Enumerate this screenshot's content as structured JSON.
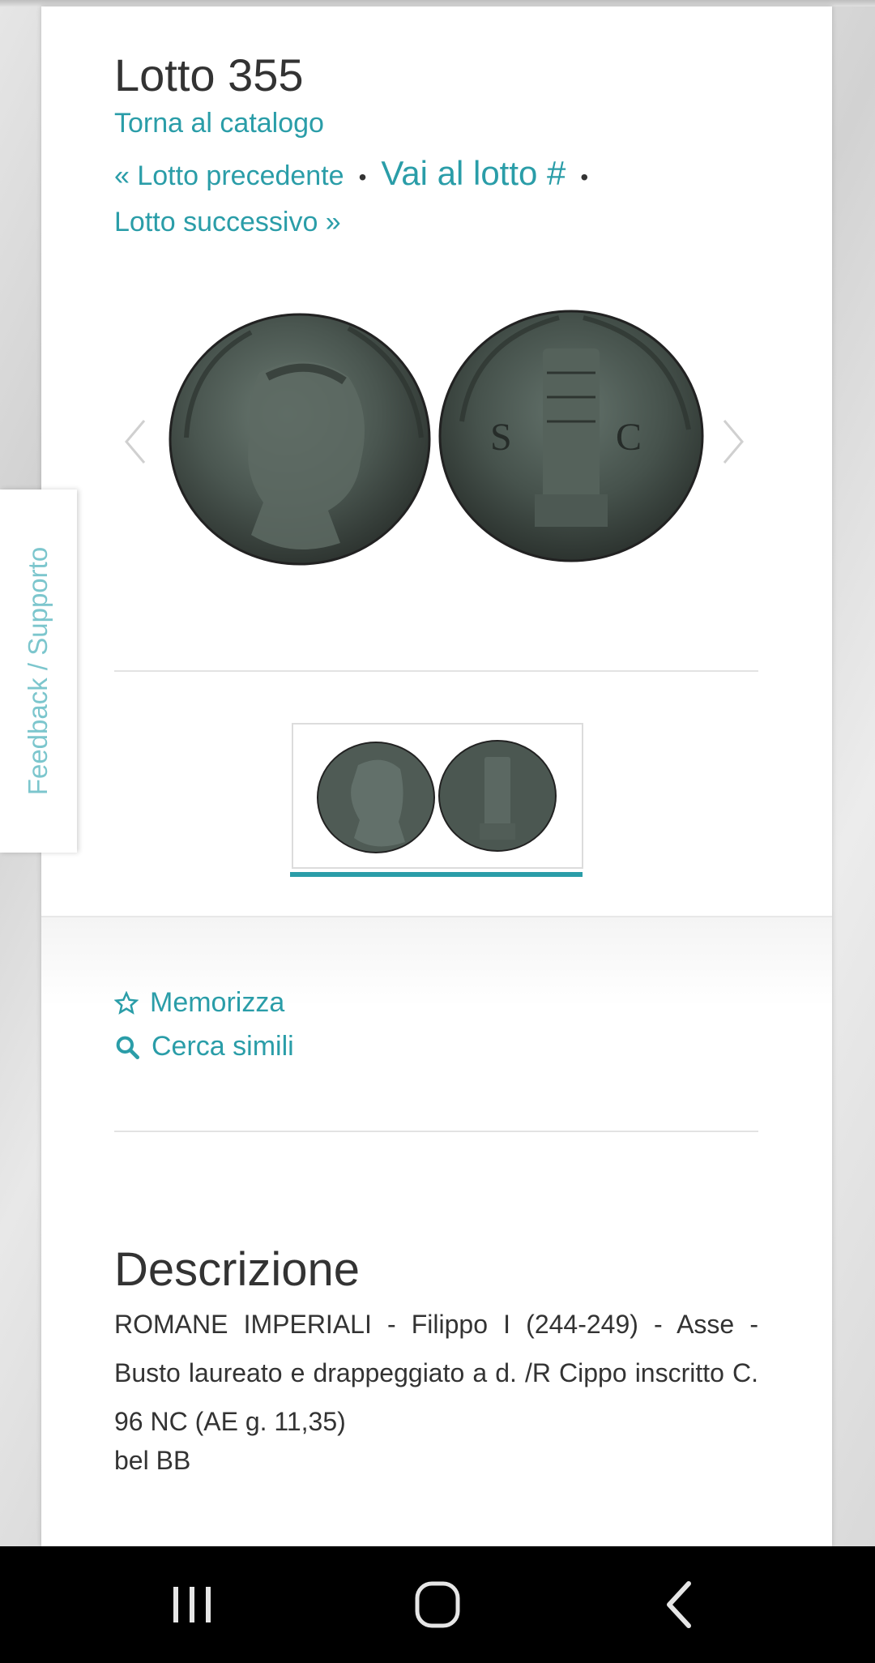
{
  "lot": {
    "title": "Lotto 355",
    "back_link": "Torna al catalogo",
    "prev_link": "« Lotto precedente",
    "goto_link": "Vai al lotto #",
    "next_link": "Lotto successivo »"
  },
  "feedback_tab": "Feedback / Supporto",
  "actions": {
    "save": "Memorizza",
    "search_similar": "Cerca simili"
  },
  "description": {
    "heading": "Descrizione",
    "text": "ROMANE IMPERIALI - Filippo I (244-249) - Asse - Busto laureato e drappeggiato a d. /R Cippo inscritto C. 96 NC (AE g. 11,35)",
    "grade": "bel BB"
  },
  "colors": {
    "accent": "#2a9da8",
    "text": "#333333"
  },
  "icons": [
    "chevron-left-icon",
    "chevron-right-icon",
    "star-outline-icon",
    "search-icon",
    "recent-apps-icon",
    "home-icon",
    "back-icon"
  ]
}
